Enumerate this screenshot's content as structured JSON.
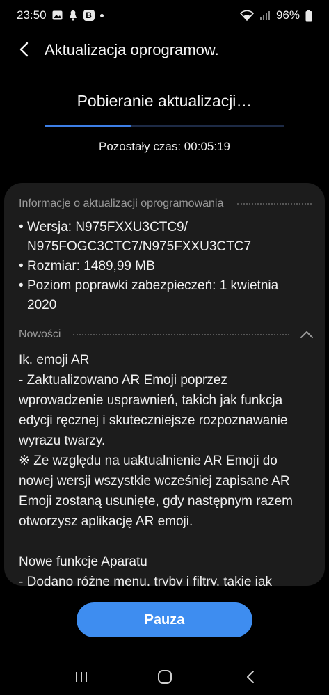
{
  "status_bar": {
    "time": "23:50",
    "left_icons": [
      "gallery-icon",
      "notification-icon",
      "b-app-icon"
    ],
    "b_label": "B",
    "battery": "96%"
  },
  "header": {
    "title": "Aktualizacja oprogramow."
  },
  "download": {
    "title": "Pobieranie aktualizacji…",
    "progress_fraction": 0.36,
    "time_remaining": "Pozostały czas: 00:05:19"
  },
  "info": {
    "section_label": "Informacje o aktualizacji oprogramowania",
    "version_line1": "Wersja: N975FXXU3CTC9/",
    "version_line2": "N975FOGC3CTC7/N975FXXU3CTC7",
    "size": "Rozmiar: 1489,99 MB",
    "patch_line1": "Poziom poprawki zabezpieczeń: 1 kwietnia",
    "patch_line2": "2020"
  },
  "news": {
    "section_label": "Nowości",
    "lines": [
      "Ik. emoji AR",
      "- Zaktualizowano AR Emoji poprzez",
      "wprowadzenie usprawnień, takich jak funkcja",
      "edycji ręcznej i skuteczniejsze rozpoznawanie",
      "wyrazu twarzy.",
      "※ Ze względu na uaktualnienie AR Emoji do",
      "nowej wersji wszystkie wcześniej zapisane AR",
      "Emoji zostaną usunięte, gdy następnym razem",
      "otworzysz aplikację AR emoji.",
      "Nowe funkcje Aparatu",
      "- Dodano różne menu, tryby i filtry, takie jak"
    ]
  },
  "actions": {
    "pause_label": "Pauza"
  },
  "colors": {
    "accent": "#3e8df0",
    "progress": "#3d7fe6",
    "card_bg": "#1c1c1c"
  }
}
